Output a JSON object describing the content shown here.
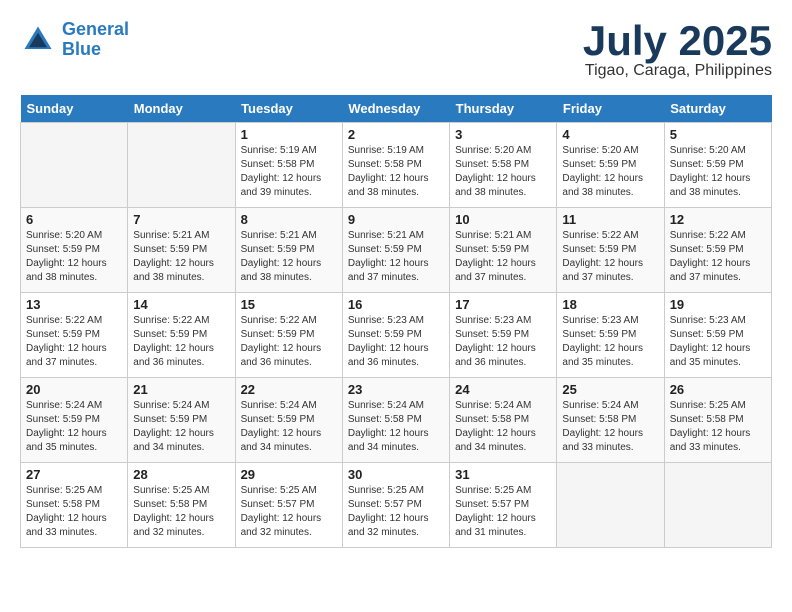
{
  "header": {
    "logo_line1": "General",
    "logo_line2": "Blue",
    "month": "July 2025",
    "location": "Tigao, Caraga, Philippines"
  },
  "days_of_week": [
    "Sunday",
    "Monday",
    "Tuesday",
    "Wednesday",
    "Thursday",
    "Friday",
    "Saturday"
  ],
  "weeks": [
    [
      {
        "day": "",
        "empty": true
      },
      {
        "day": "",
        "empty": true
      },
      {
        "day": "1",
        "sunrise": "5:19 AM",
        "sunset": "5:58 PM",
        "daylight": "12 hours and 39 minutes."
      },
      {
        "day": "2",
        "sunrise": "5:19 AM",
        "sunset": "5:58 PM",
        "daylight": "12 hours and 38 minutes."
      },
      {
        "day": "3",
        "sunrise": "5:20 AM",
        "sunset": "5:58 PM",
        "daylight": "12 hours and 38 minutes."
      },
      {
        "day": "4",
        "sunrise": "5:20 AM",
        "sunset": "5:59 PM",
        "daylight": "12 hours and 38 minutes."
      },
      {
        "day": "5",
        "sunrise": "5:20 AM",
        "sunset": "5:59 PM",
        "daylight": "12 hours and 38 minutes."
      }
    ],
    [
      {
        "day": "6",
        "sunrise": "5:20 AM",
        "sunset": "5:59 PM",
        "daylight": "12 hours and 38 minutes."
      },
      {
        "day": "7",
        "sunrise": "5:21 AM",
        "sunset": "5:59 PM",
        "daylight": "12 hours and 38 minutes."
      },
      {
        "day": "8",
        "sunrise": "5:21 AM",
        "sunset": "5:59 PM",
        "daylight": "12 hours and 38 minutes."
      },
      {
        "day": "9",
        "sunrise": "5:21 AM",
        "sunset": "5:59 PM",
        "daylight": "12 hours and 37 minutes."
      },
      {
        "day": "10",
        "sunrise": "5:21 AM",
        "sunset": "5:59 PM",
        "daylight": "12 hours and 37 minutes."
      },
      {
        "day": "11",
        "sunrise": "5:22 AM",
        "sunset": "5:59 PM",
        "daylight": "12 hours and 37 minutes."
      },
      {
        "day": "12",
        "sunrise": "5:22 AM",
        "sunset": "5:59 PM",
        "daylight": "12 hours and 37 minutes."
      }
    ],
    [
      {
        "day": "13",
        "sunrise": "5:22 AM",
        "sunset": "5:59 PM",
        "daylight": "12 hours and 37 minutes."
      },
      {
        "day": "14",
        "sunrise": "5:22 AM",
        "sunset": "5:59 PM",
        "daylight": "12 hours and 36 minutes."
      },
      {
        "day": "15",
        "sunrise": "5:22 AM",
        "sunset": "5:59 PM",
        "daylight": "12 hours and 36 minutes."
      },
      {
        "day": "16",
        "sunrise": "5:23 AM",
        "sunset": "5:59 PM",
        "daylight": "12 hours and 36 minutes."
      },
      {
        "day": "17",
        "sunrise": "5:23 AM",
        "sunset": "5:59 PM",
        "daylight": "12 hours and 36 minutes."
      },
      {
        "day": "18",
        "sunrise": "5:23 AM",
        "sunset": "5:59 PM",
        "daylight": "12 hours and 35 minutes."
      },
      {
        "day": "19",
        "sunrise": "5:23 AM",
        "sunset": "5:59 PM",
        "daylight": "12 hours and 35 minutes."
      }
    ],
    [
      {
        "day": "20",
        "sunrise": "5:24 AM",
        "sunset": "5:59 PM",
        "daylight": "12 hours and 35 minutes."
      },
      {
        "day": "21",
        "sunrise": "5:24 AM",
        "sunset": "5:59 PM",
        "daylight": "12 hours and 34 minutes."
      },
      {
        "day": "22",
        "sunrise": "5:24 AM",
        "sunset": "5:59 PM",
        "daylight": "12 hours and 34 minutes."
      },
      {
        "day": "23",
        "sunrise": "5:24 AM",
        "sunset": "5:58 PM",
        "daylight": "12 hours and 34 minutes."
      },
      {
        "day": "24",
        "sunrise": "5:24 AM",
        "sunset": "5:58 PM",
        "daylight": "12 hours and 34 minutes."
      },
      {
        "day": "25",
        "sunrise": "5:24 AM",
        "sunset": "5:58 PM",
        "daylight": "12 hours and 33 minutes."
      },
      {
        "day": "26",
        "sunrise": "5:25 AM",
        "sunset": "5:58 PM",
        "daylight": "12 hours and 33 minutes."
      }
    ],
    [
      {
        "day": "27",
        "sunrise": "5:25 AM",
        "sunset": "5:58 PM",
        "daylight": "12 hours and 33 minutes."
      },
      {
        "day": "28",
        "sunrise": "5:25 AM",
        "sunset": "5:58 PM",
        "daylight": "12 hours and 32 minutes."
      },
      {
        "day": "29",
        "sunrise": "5:25 AM",
        "sunset": "5:57 PM",
        "daylight": "12 hours and 32 minutes."
      },
      {
        "day": "30",
        "sunrise": "5:25 AM",
        "sunset": "5:57 PM",
        "daylight": "12 hours and 32 minutes."
      },
      {
        "day": "31",
        "sunrise": "5:25 AM",
        "sunset": "5:57 PM",
        "daylight": "12 hours and 31 minutes."
      },
      {
        "day": "",
        "empty": true
      },
      {
        "day": "",
        "empty": true
      }
    ]
  ]
}
